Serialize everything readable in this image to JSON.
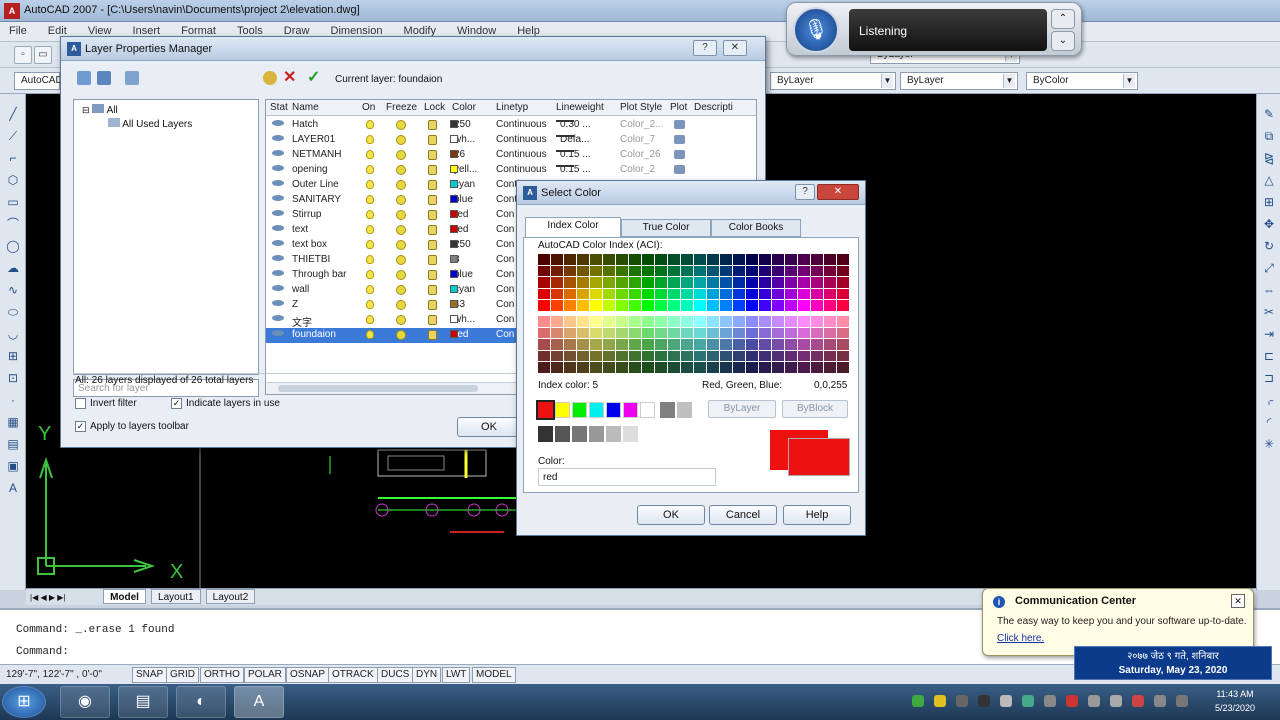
{
  "app": {
    "title": "AutoCAD 2007 - [C:\\Users\\navin\\Documents\\project 2\\elevation.dwg]",
    "menu": [
      "File",
      "Edit",
      "View",
      "Insert",
      "Format",
      "Tools",
      "Draw",
      "Dimension",
      "Modify",
      "Window",
      "Help"
    ]
  },
  "toolbar": {
    "workspace": "AutoCAD",
    "linetype": "ByLayer",
    "lineweight": "ByLayer",
    "plotstyle": "ByColor",
    "color": "ByLayer"
  },
  "listening": {
    "status": "Listening"
  },
  "layer_manager": {
    "title": "Layer Properties Manager",
    "current_layer": "Current layer: foundaion",
    "tree": {
      "root": "All",
      "child": "All Used Layers"
    },
    "search_placeholder": "Search for layer",
    "status": "All: 26 layers displayed of 26 total layers",
    "columns": [
      "Stat",
      "Name",
      "On",
      "Freeze",
      "Lock",
      "Color",
      "Linetyp",
      "Lineweight",
      "Plot Style",
      "Plot",
      "Descripti"
    ],
    "rows": [
      {
        "name": "Hatch",
        "color_name": "250",
        "color_hex": "#333333",
        "linetype": "Continuous",
        "lineweight": "0.30 ...",
        "plotstyle": "Color_2..."
      },
      {
        "name": "LAYER01",
        "color_name": "wh...",
        "color_hex": "#ffffff",
        "linetype": "Continuous",
        "lineweight": "Defa...",
        "plotstyle": "Color_7"
      },
      {
        "name": "NETMANH",
        "color_name": "26",
        "color_hex": "#7a3b10",
        "linetype": "Continuous",
        "lineweight": "0.15 ...",
        "plotstyle": "Color_26"
      },
      {
        "name": "opening",
        "color_name": "yell...",
        "color_hex": "#ffff00",
        "linetype": "Continuous",
        "lineweight": "0.15 ...",
        "plotstyle": "Color_2"
      },
      {
        "name": "Outer Line",
        "color_name": "cyan",
        "color_hex": "#00cccc",
        "linetype": "Continuous",
        "lineweight": "",
        "plotstyle": ""
      },
      {
        "name": "SANITARY",
        "color_name": "blue",
        "color_hex": "#0000cc",
        "linetype": "Continuous",
        "lineweight": "",
        "plotstyle": ""
      },
      {
        "name": "Stirrup",
        "color_name": "red",
        "color_hex": "#cc0000",
        "linetype": "Con",
        "lineweight": "",
        "plotstyle": ""
      },
      {
        "name": "text",
        "color_name": "red",
        "color_hex": "#cc0000",
        "linetype": "Con",
        "lineweight": "",
        "plotstyle": ""
      },
      {
        "name": "text box",
        "color_name": "250",
        "color_hex": "#333333",
        "linetype": "Con",
        "lineweight": "",
        "plotstyle": ""
      },
      {
        "name": "THIETBI",
        "color_name": "8",
        "color_hex": "#808080",
        "linetype": "Con",
        "lineweight": "",
        "plotstyle": ""
      },
      {
        "name": "Through bar",
        "color_name": "blue",
        "color_hex": "#0000cc",
        "linetype": "Con",
        "lineweight": "",
        "plotstyle": ""
      },
      {
        "name": "wall",
        "color_name": "cyan",
        "color_hex": "#00cccc",
        "linetype": "Con",
        "lineweight": "",
        "plotstyle": ""
      },
      {
        "name": "Z",
        "color_name": "43",
        "color_hex": "#9a6b2a",
        "linetype": "Con",
        "lineweight": "",
        "plotstyle": ""
      },
      {
        "name": "文字",
        "color_name": "wh...",
        "color_hex": "#ffffff",
        "linetype": "Con",
        "lineweight": "",
        "plotstyle": ""
      },
      {
        "name": "foundaion",
        "color_name": "red",
        "color_hex": "#cc0000",
        "linetype": "Con",
        "lineweight": "",
        "plotstyle": "",
        "selected": true
      }
    ],
    "invert_filter": "Invert filter",
    "indicate_layers": "Indicate layers in use",
    "apply_toolbar": "Apply to layers toolbar",
    "ok": "OK"
  },
  "select_color": {
    "title": "Select Color",
    "tabs": [
      "Index Color",
      "True Color",
      "Color Books"
    ],
    "aci_label": "AutoCAD Color Index (ACI):",
    "index_color": "Index color:  5",
    "rgb_label": "Red, Green, Blue:",
    "rgb_value": "0,0,255",
    "bylayer": "ByLayer",
    "byblock": "ByBlock",
    "color_label": "Color:",
    "color_value": "red",
    "ok": "OK",
    "cancel": "Cancel",
    "help": "Help"
  },
  "tabs": [
    "Model",
    "Layout1",
    "Layout2"
  ],
  "command": {
    "line1": "Command:  _.erase 1 found",
    "line2": "Command:"
  },
  "status": {
    "coords": "129'-7\", 122'-7\" , 0'-0\"",
    "buttons": [
      "SNAP",
      "GRID",
      "ORTHO",
      "POLAR",
      "OSNAP",
      "OTRACK",
      "DUCS",
      "DYN",
      "LWT",
      "MODEL"
    ]
  },
  "comm_center": {
    "title": "Communication Center",
    "message": "The easy way to keep you and your software up-to-date.",
    "link": "Click here."
  },
  "date_widget": {
    "line1": "२०७७ जेठ ९ गते, शनिबार",
    "line2": "Saturday, May 23, 2020"
  },
  "clock": {
    "time": "11:43 AM",
    "date": "5/23/2020"
  }
}
